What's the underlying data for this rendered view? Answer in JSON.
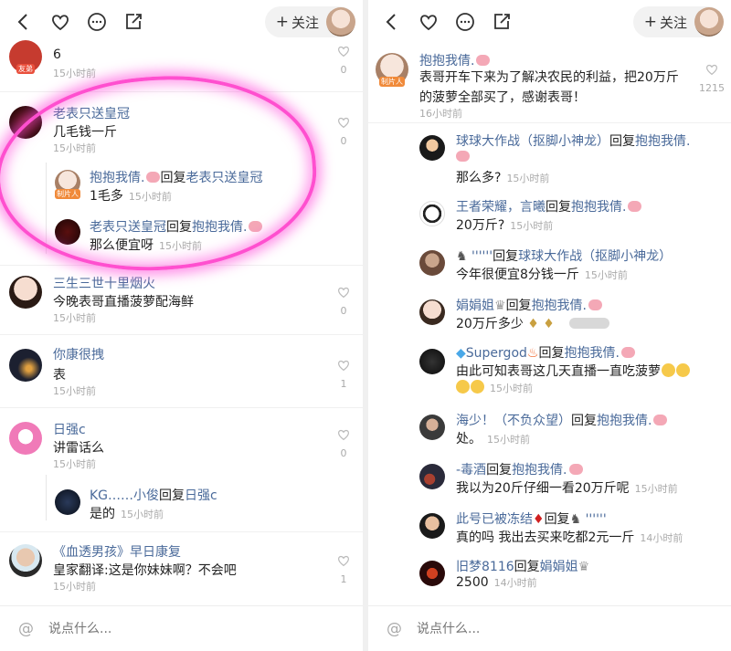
{
  "header": {
    "follow_label": "关注",
    "follow_plus": "+"
  },
  "left": {
    "comments": [
      {
        "name": "",
        "text": "6",
        "time": "15小时前",
        "likes": "0",
        "badge": "友弟"
      },
      {
        "name": "老表只送皇冠",
        "text": "几毛钱一斤",
        "time": "15小时前",
        "likes": "0"
      },
      {
        "name": "抱抱我倩.",
        "reply_word": "回复",
        "target": "老表只送皇冠",
        "text": "1毛多",
        "time": "15小时前",
        "badge": "制片人"
      },
      {
        "name": "老表只送皇冠",
        "reply_word": "回复",
        "target": "抱抱我倩.",
        "text": "那么便宜呀",
        "time": "15小时前"
      },
      {
        "name": "三生三世十里烟火",
        "text": "今晚表哥直播菠萝配海鲜",
        "time": "15小时前",
        "likes": "0"
      },
      {
        "name": "你康很拽",
        "text": "表",
        "time": "15小时前",
        "likes": "1"
      },
      {
        "name": "日强c",
        "text": "讲雷话么",
        "time": "15小时前",
        "likes": "0"
      },
      {
        "name": "KG……小俊",
        "reply_word": "回复",
        "target": "日强c",
        "text": "是的",
        "time": "15小时前"
      },
      {
        "name": "《血透男孩》早日康复",
        "text": "皇家翻译:这是你妹妹啊？不会吧",
        "time": "15小时前",
        "likes": "1"
      }
    ]
  },
  "right": {
    "main": {
      "name": "抱抱我倩.",
      "text": "表哥开车下来为了解决农民的利益，把20万斤的菠萝全部买了，感谢表哥！",
      "time": "16小时前",
      "likes": "1215",
      "badge": "制片人"
    },
    "replies": [
      {
        "name": "球球大作战（抠脚小神龙）",
        "reply_word": "回复",
        "target": "抱抱我倩.",
        "text": "那么多?",
        "time": "15小时前"
      },
      {
        "name": "王者荣耀，言曦",
        "reply_word": "回复",
        "target": "抱抱我倩.",
        "text": "20万斤?",
        "time": "15小时前"
      },
      {
        "name": "''''''",
        "reply_word": "回复",
        "target": "球球大作战（抠脚小神龙）",
        "text": "今年很便宜8分钱一斤",
        "time": "15小时前"
      },
      {
        "name": "娟娟姐",
        "reply_word": "回复",
        "target": "抱抱我倩.",
        "text": "20万斤多少",
        "time": ""
      },
      {
        "name": "Supergod",
        "reply_word": "回复",
        "target": "抱抱我倩.",
        "text": "由此可知表哥这几天直播一直吃菠萝",
        "time": "15小时前"
      },
      {
        "name": "海少！（不负众望）",
        "reply_word": "回复",
        "target": "抱抱我倩.",
        "text": "处。",
        "time": "15小时前"
      },
      {
        "name": "-毒酒",
        "reply_word": "回复",
        "target": "抱抱我倩.",
        "text": "我以为20斤仔细一看20万斤呢",
        "time": "15小时前"
      },
      {
        "name": "此号已被冻结",
        "reply_word": "回复",
        "target": "''''''",
        "text": "真的吗  我出去买来吃都2元一斤",
        "time": "14小时前"
      },
      {
        "name": "旧梦8116",
        "reply_word": "回复",
        "target": "娟娟姐",
        "text": "2500",
        "time": "14小时前"
      }
    ]
  },
  "bottom": {
    "placeholder": "说点什么..."
  }
}
